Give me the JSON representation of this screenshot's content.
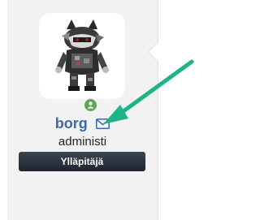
{
  "profile": {
    "username": "borg",
    "title": "administi",
    "role_badge": "Ylläpitäjä",
    "online": true
  },
  "icons": {
    "status": "online-user-icon",
    "message": "envelope-icon",
    "annotation": "arrow-icon"
  },
  "colors": {
    "username": "#3b6aa5",
    "online": "#5aa84f",
    "badge_bg": "#262c37",
    "arrow": "#1fb38a"
  }
}
